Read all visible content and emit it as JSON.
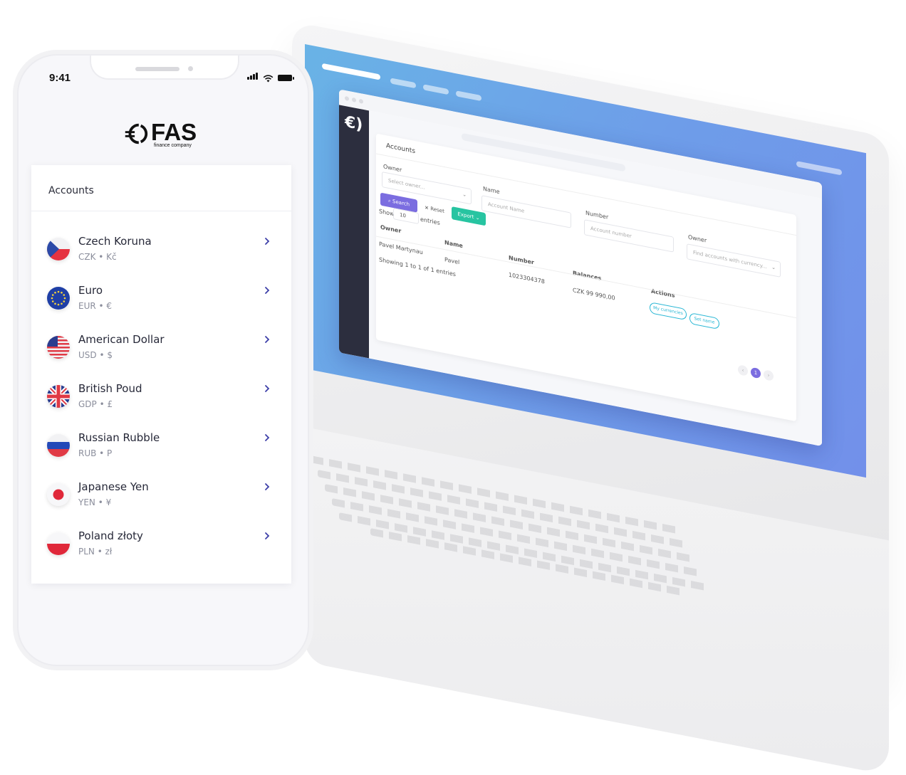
{
  "phone": {
    "status_time": "9:41",
    "brand": {
      "name": "FAS",
      "subtitle": "finance company"
    },
    "accounts_title": "Accounts",
    "accounts": [
      {
        "name": "Czech Koruna",
        "code": "CZK • Kč",
        "flag": "cz-flag-icon"
      },
      {
        "name": "Euro",
        "code": "EUR • €",
        "flag": "eu-flag-icon"
      },
      {
        "name": "American Dollar",
        "code": "USD • $",
        "flag": "us-flag-icon"
      },
      {
        "name": "British Poud",
        "code": "GDP • £",
        "flag": "uk-flag-icon"
      },
      {
        "name": "Russian Rubble",
        "code": "RUB • P",
        "flag": "ru-flag-icon"
      },
      {
        "name": "Japanese Yen",
        "code": "YEN • ¥",
        "flag": "jp-flag-icon"
      },
      {
        "name": "Poland złoty",
        "code": "PLN • zł",
        "flag": "pl-flag-icon"
      }
    ]
  },
  "laptop": {
    "page_title": "Accounts",
    "filters": {
      "owner_label": "Owner",
      "owner_placeholder": "Select owner...",
      "name_label": "Name",
      "name_placeholder": "Account Name",
      "number_label": "Number",
      "number_placeholder": "Account number",
      "owner2_label": "Owner",
      "owner2_placeholder": "Find accounts with currency..."
    },
    "buttons": {
      "search": "Search",
      "reset": "Reset",
      "export": "Export"
    },
    "show": {
      "label": "Show",
      "value": "10",
      "suffix": "entries"
    },
    "table": {
      "headers": [
        "Owner",
        "Name",
        "Number",
        "Balances",
        "Actions"
      ],
      "rows": [
        {
          "owner": "Pavel Martynau",
          "name": "Pavel",
          "number": "1023304378",
          "balance": "CZK 99 990,00",
          "actions": [
            "My currencies",
            "Set name"
          ]
        }
      ],
      "footer": "Showing 1 to 1 of 1 entries",
      "page": "1"
    }
  },
  "colors": {
    "screen_gradient_start": "#69b3e6",
    "screen_gradient_end": "#7290ea",
    "sidebar": "#2c2e3e",
    "search_button": "#7b6de0",
    "export_button": "#27c4a1",
    "action_pill": "#27b6d4",
    "page_active": "#7b6de0",
    "chevron": "#3d3fa8"
  }
}
